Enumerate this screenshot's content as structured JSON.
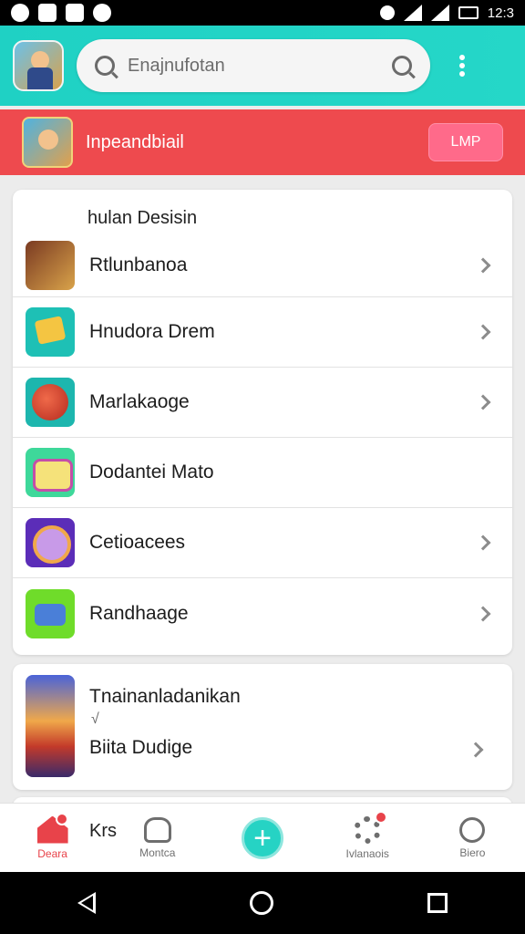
{
  "status_bar": {
    "time": "12:3",
    "icons": [
      "app-icon",
      "notification-icon",
      "photo-icon",
      "info-icon",
      "alarm-icon",
      "wifi-icon",
      "signal-icon",
      "battery-icon"
    ]
  },
  "top_bar": {
    "search_placeholder": "Enajnufotan",
    "accent": "#22d4c6"
  },
  "promo": {
    "title": "Inpeandbiail",
    "button": "LMP",
    "color": "#ee4a4e"
  },
  "list": {
    "header": "hulan Desisin",
    "items": [
      {
        "label": "Rtlunbanoa"
      },
      {
        "label": "Hnudora Drem"
      },
      {
        "label": "Marlakaoge"
      },
      {
        "label": "Dodantei Mato"
      },
      {
        "label": "Cetioacees"
      },
      {
        "label": "Randhaage"
      }
    ]
  },
  "featured": {
    "title": "Tnainanladanikan",
    "mark": "√",
    "subtitle": "Biita Dudige"
  },
  "bottom_nav": {
    "home": "Deara",
    "krs": "Krs",
    "people": "Montca",
    "add": "+",
    "settings": "Ivlanaois",
    "search": "Biero"
  }
}
